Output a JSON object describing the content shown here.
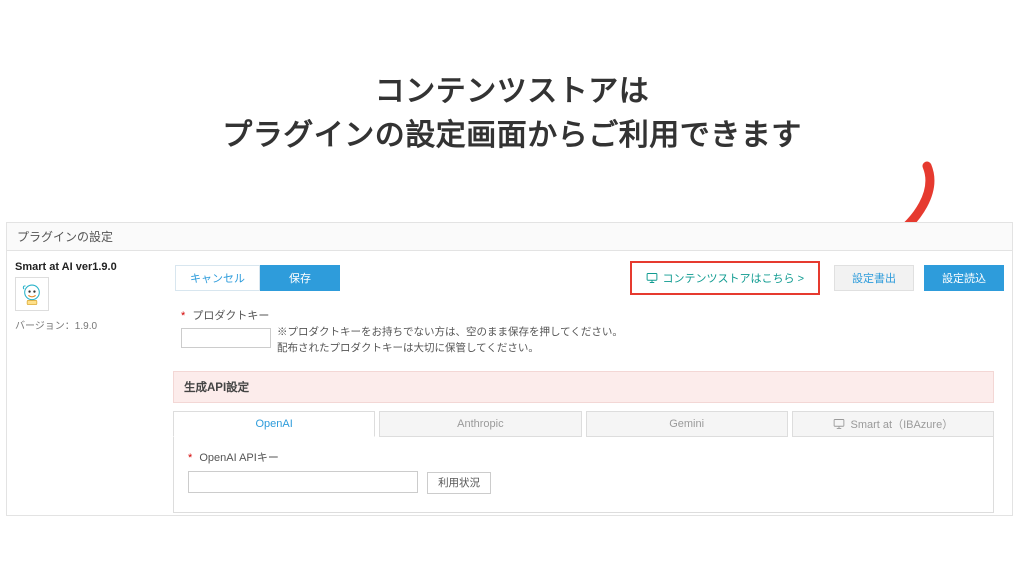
{
  "headline": {
    "line1": "コンテンツストアは",
    "line2": "プラグインの設定画面からご利用できます"
  },
  "panel": {
    "title": "プラグインの設定"
  },
  "plugin": {
    "name": "Smart at AI ver1.9.0",
    "version_label": "バージョン：1.9.0"
  },
  "toolbar": {
    "cancel": "キャンセル",
    "save": "保存",
    "store": "コンテンツストアはこちら >",
    "export": "設定書出",
    "import": "設定読込"
  },
  "product_key": {
    "label": "プロダクトキー",
    "help1": "※プロダクトキーをお持ちでない方は、空のまま保存を押してください。",
    "help2": "配布されたプロダクトキーは大切に保管してください。",
    "value": ""
  },
  "api_section": {
    "title": "生成API設定"
  },
  "tabs": {
    "items": [
      {
        "label": "OpenAI"
      },
      {
        "label": "Anthropic"
      },
      {
        "label": "Gemini"
      },
      {
        "label": "Smart at（IBAzure）"
      }
    ]
  },
  "openai": {
    "label": "OpenAI APIキー",
    "value": "",
    "usage_btn": "利用状況"
  }
}
